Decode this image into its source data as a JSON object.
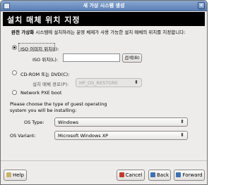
{
  "window": {
    "title": "새 가상 시스템 생성",
    "close": "✕"
  },
  "header": {
    "title": "설치 매체 위치 지정"
  },
  "description": {
    "bold": "완전 가상화",
    "rest": " 시스템에 설치하려는 운영 체제가 사용 가능한 설치 매체의 위치를 지정합니다:"
  },
  "iso": {
    "radio_label": "ISO 이미지 위치(I):",
    "location_label": "ISO 위치(L):",
    "location_value": "",
    "browse_label": "검색(B)"
  },
  "cdrom": {
    "radio_label": "CD-ROM 또는 DVD(C):",
    "path_label": "설치 매체 경로(P):",
    "path_value": "HP_OS_RESTORE"
  },
  "pxe": {
    "radio_label": "Network PXE boot"
  },
  "guest": {
    "prompt_line1": "Please choose the type of guest operating",
    "prompt_line2": "system you will be installing:",
    "os_type_label": "OS Type:",
    "os_type_value": "Windows",
    "os_variant_label": "OS Variant:",
    "os_variant_value": "Microsoft Windows XP"
  },
  "footer": {
    "help": "Help",
    "cancel": "Cancel",
    "back": "Back",
    "forward": "Forward"
  },
  "colors": {
    "header_bg": "#000000",
    "titlebar": "#6f8fc2",
    "window_bg": "#edeceb"
  }
}
